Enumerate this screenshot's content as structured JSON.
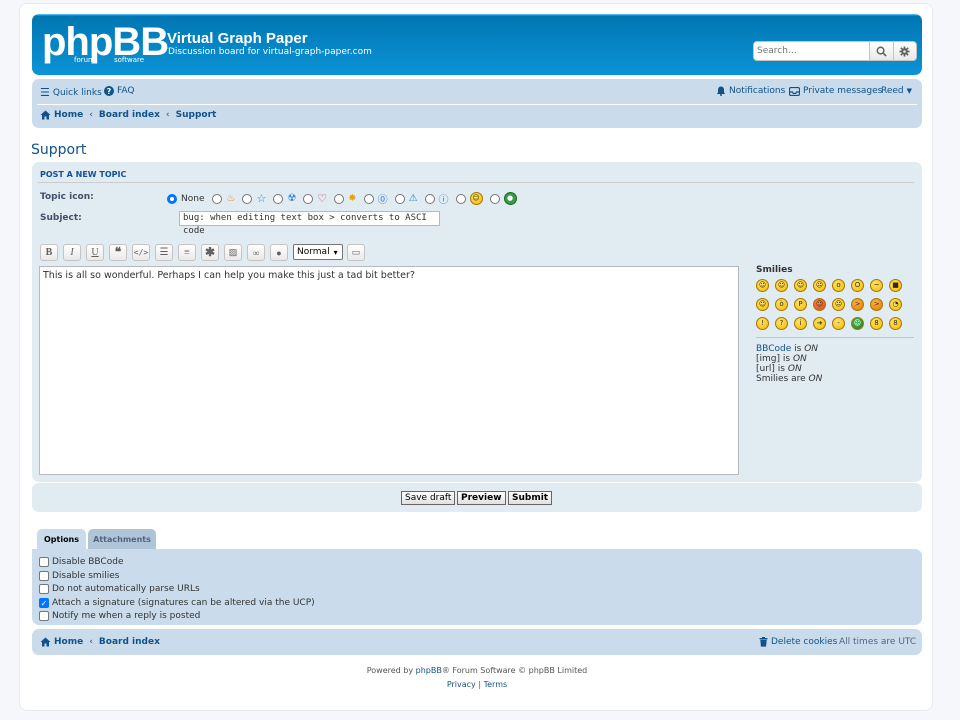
{
  "header": {
    "logo_text": "phpBB",
    "logo_sub1": "forum",
    "logo_sub2": "software",
    "site_name": "Virtual Graph Paper",
    "site_desc": "Discussion board for virtual-graph-paper.com",
    "search_placeholder": "Search…"
  },
  "navbar": {
    "quick_links": "Quick links",
    "faq": "FAQ",
    "notifications": "Notifications",
    "private_messages": "Private messages",
    "user": "Reed",
    "breadcrumbs": [
      "Home",
      "Board index",
      "Support"
    ]
  },
  "page_title": "Support",
  "post": {
    "heading": "POST A NEW TOPIC",
    "topic_icon_label": "Topic icon:",
    "topic_icon_none": "None",
    "subject_label": "Subject:",
    "subject_value": "bug: when editing text box > converts to ASCI code",
    "font_size_value": "Normal",
    "message": "This is all so wonderful. Perhaps I can help you make this just a tad bit better?"
  },
  "toolbar": [
    "B",
    "I",
    "U",
    "quote",
    "code",
    "list",
    "list-numbered",
    "list-item",
    "image",
    "link",
    "color",
    "font-size",
    "preview"
  ],
  "smilies": {
    "title": "Smilies",
    "bbcode_label": "BBCode",
    "bbcode_is": "is",
    "bbcode_state": "ON",
    "img_label": "[img] is",
    "img_state": "ON",
    "url_label": "[url] is",
    "url_state": "ON",
    "smilies_label": "Smilies are",
    "smilies_state": "ON"
  },
  "buttons": {
    "save_draft": "Save draft",
    "preview": "Preview",
    "submit": "Submit"
  },
  "tabs": [
    "Options",
    "Attachments"
  ],
  "options": [
    {
      "label": "Disable BBCode",
      "checked": false
    },
    {
      "label": "Disable smilies",
      "checked": false
    },
    {
      "label": "Do not automatically parse URLs",
      "checked": false
    },
    {
      "label": "Attach a signature (signatures can be altered via the UCP)",
      "checked": true
    },
    {
      "label": "Notify me when a reply is posted",
      "checked": false
    }
  ],
  "footer_nav": {
    "home": "Home",
    "board_index": "Board index",
    "delete_cookies": "Delete cookies",
    "timezone": "All times are UTC"
  },
  "footer": {
    "powered_pre": "Powered by",
    "phpbb": "phpBB",
    "powered_post": "® Forum Software © phpBB Limited",
    "privacy": "Privacy",
    "divider": "|",
    "terms": "Terms"
  },
  "colors": {
    "header_blue": "#12a3eb",
    "navbar_bg": "#cadceb",
    "panel_bg": "#e1ebf2",
    "link": "#105289"
  }
}
